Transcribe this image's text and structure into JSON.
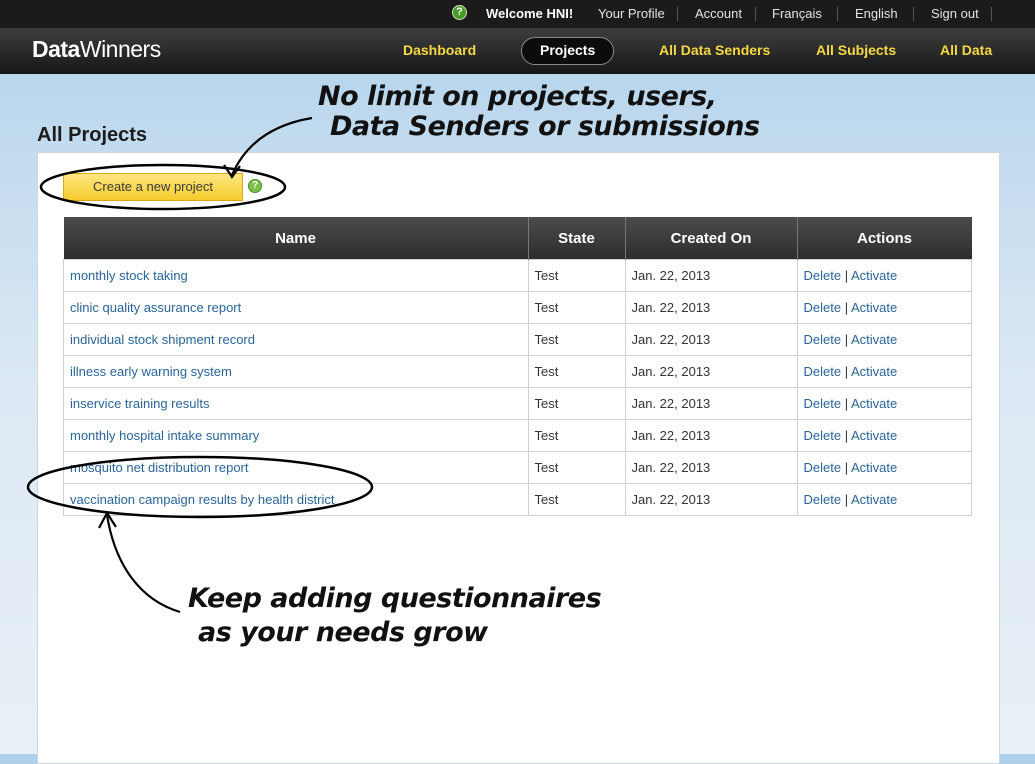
{
  "topbar": {
    "welcome": "Welcome HNI!",
    "links": [
      "Your Profile",
      "Account",
      "Français",
      "English",
      "Sign out"
    ]
  },
  "nav": {
    "logo_bold": "Data",
    "logo_light": "Winners",
    "items": [
      "Dashboard",
      "Projects",
      "All Data Senders",
      "All Subjects",
      "All Data"
    ],
    "active": "Projects"
  },
  "page": {
    "title": "All Projects",
    "create_button": "Create a new project"
  },
  "table": {
    "headers": [
      "Name",
      "State",
      "Created On",
      "Actions"
    ],
    "actions": [
      "Delete",
      "|",
      "Activate"
    ],
    "rows": [
      {
        "name": "monthly stock taking",
        "state": "Test",
        "created": "Jan. 22, 2013"
      },
      {
        "name": "clinic quality assurance report",
        "state": "Test",
        "created": "Jan. 22, 2013"
      },
      {
        "name": "individual stock shipment record",
        "state": "Test",
        "created": "Jan. 22, 2013"
      },
      {
        "name": "illness early warning system",
        "state": "Test",
        "created": "Jan. 22, 2013"
      },
      {
        "name": "inservice training results",
        "state": "Test",
        "created": "Jan. 22, 2013"
      },
      {
        "name": "monthly hospital intake summary",
        "state": "Test",
        "created": "Jan. 22, 2013"
      },
      {
        "name": "mosquito net distribution report",
        "state": "Test",
        "created": "Jan. 22, 2013"
      },
      {
        "name": "vaccination campaign results by health district",
        "state": "Test",
        "created": "Jan. 22, 2013"
      }
    ]
  },
  "annotations": {
    "top_line1": "No limit on projects, users,",
    "top_line2": "Data Senders or submissions",
    "bottom_line1": "Keep adding questionnaires",
    "bottom_line2": "as your needs grow"
  },
  "colors": {
    "nav_link": "#f6d843",
    "link": "#2a6496",
    "button": "#f6cd2c"
  },
  "icons": [
    "help-icon"
  ]
}
